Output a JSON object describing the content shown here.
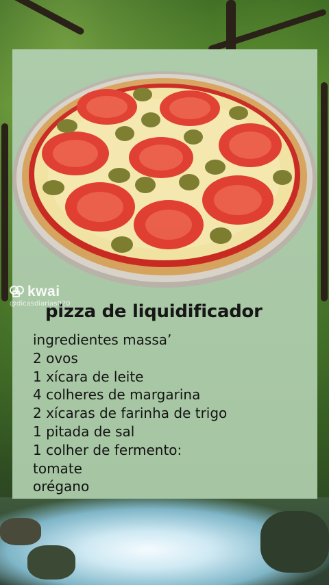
{
  "watermark": {
    "brand": "kwai",
    "handle": "@dicasdiarias020",
    "logo_icon": "kwai-logo-icon"
  },
  "recipe": {
    "title": "pizza de liquidificador",
    "lines": [
      "ingredientes massa’",
      "2 ovos",
      "1 xícara de leite",
      "4 colheres de margarina",
      "2 xícaras de farinha de trigo",
      "1 pitada de sal",
      "1 colher de fermento:",
      "tomate",
      "orégano"
    ]
  },
  "colors": {
    "card_bg": "#a9c9a6",
    "text": "#111111",
    "tomato": "#e0392b",
    "olive": "#7a7a2a",
    "cheese": "#f2e3a0"
  }
}
